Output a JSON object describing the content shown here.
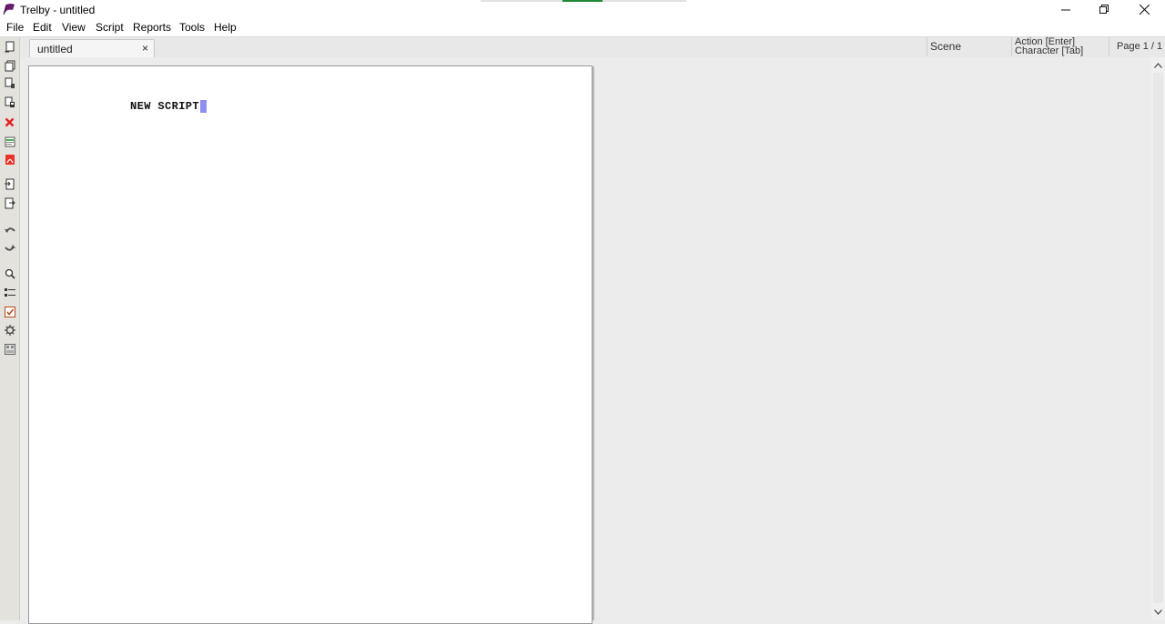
{
  "window": {
    "title": "Trelby - untitled",
    "icons": {
      "app": "trelby-logo-icon",
      "minimize": "minimize-icon",
      "maximize": "restore-icon",
      "close": "close-icon"
    }
  },
  "menu": {
    "items": [
      "File",
      "Edit",
      "View",
      "Script",
      "Reports",
      "Tools",
      "Help"
    ]
  },
  "toolbar": {
    "icons": [
      "new-script-icon",
      "open-icon",
      "save-icon",
      "save-as-icon",
      "close-script-icon",
      "import-icon",
      "export-pdf-icon",
      "copy-to-icon",
      "paste-from-icon",
      "undo-icon",
      "redo-icon",
      "find-icon",
      "name-database-icon",
      "spell-check-icon",
      "settings-icon",
      "about-icon"
    ]
  },
  "tabs": [
    {
      "label": "untitled",
      "close_glyph": "×"
    }
  ],
  "status": {
    "element_type": "Scene",
    "key_hint_enter": "Action [Enter]",
    "key_hint_tab": "Character [Tab]",
    "page": "Page 1 / 1"
  },
  "editor": {
    "lines": [
      "NEW SCRIPT"
    ],
    "cursor_color": "#8f8ff0"
  },
  "colors": {
    "toolbar_bg": "#e4e2dc",
    "editor_bg": "#ececec",
    "page_bg": "#ffffff"
  }
}
